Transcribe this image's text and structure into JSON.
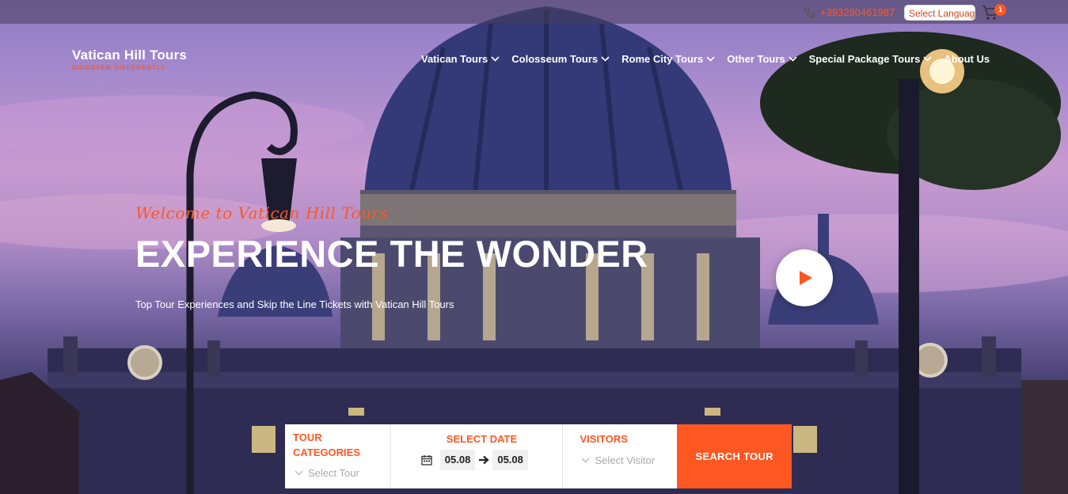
{
  "topbar": {
    "phone": "+393290461987",
    "language_button": "Select Language",
    "cart_count": "1"
  },
  "header": {
    "logo_title": "Vatican Hill Tours",
    "logo_tagline": "DISCOVER DIFFERENTLY",
    "nav": [
      {
        "label": "Vatican Tours"
      },
      {
        "label": "Colosseum Tours"
      },
      {
        "label": "Rome City Tours"
      },
      {
        "label": "Other Tours"
      },
      {
        "label": "Special Package Tours"
      },
      {
        "label": "About Us"
      }
    ]
  },
  "hero": {
    "welcome": "Welcome to Vatican Hill Tours",
    "headline": "EXPERIENCE THE WONDER",
    "subline": "Top Tour Experiences and Skip the Line Tickets with Vatican Hill Tours"
  },
  "search": {
    "categories_label_1": "TOUR",
    "categories_label_2": "CATEGORIES",
    "categories_value": "Select Tour",
    "date_label": "SELECT DATE",
    "date_from": "05.08",
    "date_to": "05.08",
    "visitors_label": "VISITORS",
    "visitors_value": "Select Visitor",
    "button": "SEARCH TOUR"
  },
  "colors": {
    "accent": "#ff5722",
    "white": "#ffffff"
  }
}
